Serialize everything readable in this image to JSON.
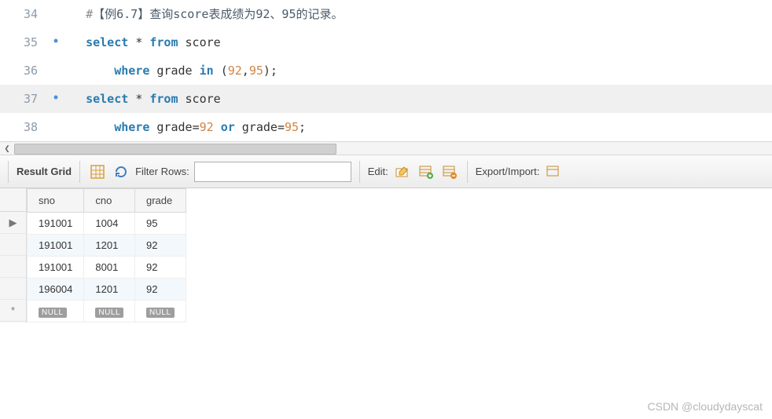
{
  "editor": {
    "lines": [
      {
        "num": "34",
        "marker": "",
        "hl": false,
        "indent": "",
        "tokens": [
          {
            "t": "#",
            "c": "comment"
          },
          {
            "t": "【例6.7】查询score表成绩为92、95的记录。",
            "c": "cjk"
          }
        ]
      },
      {
        "num": "35",
        "marker": "•",
        "hl": false,
        "indent": "",
        "tokens": [
          {
            "t": "select",
            "c": "kw"
          },
          {
            "t": " ",
            "c": "punc"
          },
          {
            "t": "*",
            "c": "punc"
          },
          {
            "t": " ",
            "c": "punc"
          },
          {
            "t": "from",
            "c": "kw"
          },
          {
            "t": " ",
            "c": "punc"
          },
          {
            "t": "score",
            "c": "ident"
          }
        ]
      },
      {
        "num": "36",
        "marker": "",
        "hl": false,
        "indent": "    ",
        "tokens": [
          {
            "t": "where",
            "c": "kw"
          },
          {
            "t": " ",
            "c": "punc"
          },
          {
            "t": "grade",
            "c": "ident"
          },
          {
            "t": " ",
            "c": "punc"
          },
          {
            "t": "in",
            "c": "kw"
          },
          {
            "t": " ",
            "c": "punc"
          },
          {
            "t": "(",
            "c": "punc"
          },
          {
            "t": "92",
            "c": "num"
          },
          {
            "t": ",",
            "c": "punc"
          },
          {
            "t": "95",
            "c": "num"
          },
          {
            "t": ")",
            "c": "punc"
          },
          {
            "t": ";",
            "c": "punc"
          }
        ]
      },
      {
        "num": "37",
        "marker": "•",
        "hl": true,
        "indent": "",
        "tokens": [
          {
            "t": "select",
            "c": "kw"
          },
          {
            "t": " ",
            "c": "punc"
          },
          {
            "t": "*",
            "c": "punc"
          },
          {
            "t": " ",
            "c": "punc"
          },
          {
            "t": "from",
            "c": "kw"
          },
          {
            "t": " ",
            "c": "punc"
          },
          {
            "t": "score",
            "c": "ident"
          }
        ]
      },
      {
        "num": "38",
        "marker": "",
        "hl": false,
        "indent": "    ",
        "tokens": [
          {
            "t": "where",
            "c": "kw"
          },
          {
            "t": " ",
            "c": "punc"
          },
          {
            "t": "grade",
            "c": "ident"
          },
          {
            "t": "=",
            "c": "punc"
          },
          {
            "t": "92",
            "c": "num"
          },
          {
            "t": " ",
            "c": "punc"
          },
          {
            "t": "or",
            "c": "kw"
          },
          {
            "t": " ",
            "c": "punc"
          },
          {
            "t": "grade",
            "c": "ident"
          },
          {
            "t": "=",
            "c": "punc"
          },
          {
            "t": "95",
            "c": "num"
          },
          {
            "t": ";",
            "c": "punc"
          }
        ]
      }
    ]
  },
  "toolbar": {
    "result_grid_label": "Result Grid",
    "filter_rows_label": "Filter Rows:",
    "filter_value": "",
    "edit_label": "Edit:",
    "export_label": "Export/Import:"
  },
  "table": {
    "columns": [
      "sno",
      "cno",
      "grade"
    ],
    "rows": [
      {
        "current": true,
        "alt": false,
        "cells": [
          "191001",
          "1004",
          "95"
        ]
      },
      {
        "current": false,
        "alt": true,
        "cells": [
          "191001",
          "1201",
          "92"
        ]
      },
      {
        "current": false,
        "alt": false,
        "cells": [
          "191001",
          "8001",
          "92"
        ]
      },
      {
        "current": false,
        "alt": true,
        "cells": [
          "196004",
          "1201",
          "92"
        ]
      }
    ],
    "null_row": {
      "marker": "*",
      "label": "NULL"
    }
  },
  "watermark": "CSDN @cloudydayscat"
}
